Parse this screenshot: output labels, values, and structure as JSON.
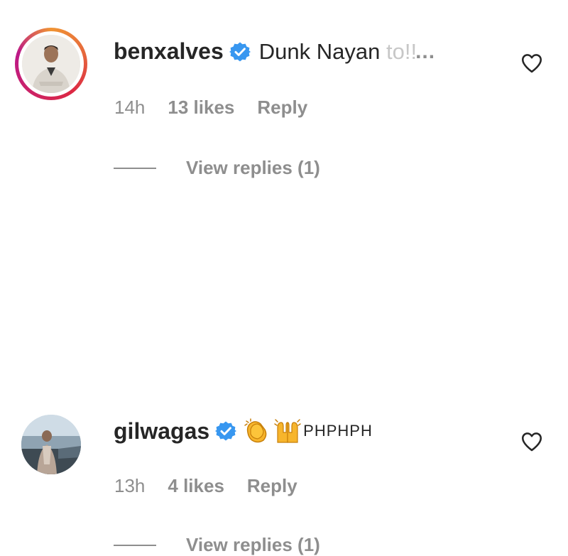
{
  "colors": {
    "text": "#262626",
    "secondary": "#8e8e8e",
    "verified_blue": "#3897f0",
    "story_ring": [
      "#f09433",
      "#dc2743",
      "#bc1888"
    ]
  },
  "comments": [
    {
      "username": "benxalves",
      "verified": true,
      "has_story_ring": true,
      "text_visible": "Dunk Nayan",
      "text_faded": "to!!",
      "more_label": "...",
      "time": "14h",
      "likes": "13 likes",
      "reply_label": "Reply",
      "view_replies_label": "View replies (1)",
      "icons": [
        "verified-badge-icon",
        "heart-icon"
      ]
    },
    {
      "username": "gilwagas",
      "verified": true,
      "has_story_ring": false,
      "emojis": [
        "clapping-hands-emoji",
        "raising-hands-emoji"
      ],
      "text_suffix": "PHPHPH",
      "time": "13h",
      "likes": "4 likes",
      "reply_label": "Reply",
      "view_replies_label": "View replies (1)",
      "icons": [
        "verified-badge-icon",
        "heart-icon"
      ]
    }
  ]
}
